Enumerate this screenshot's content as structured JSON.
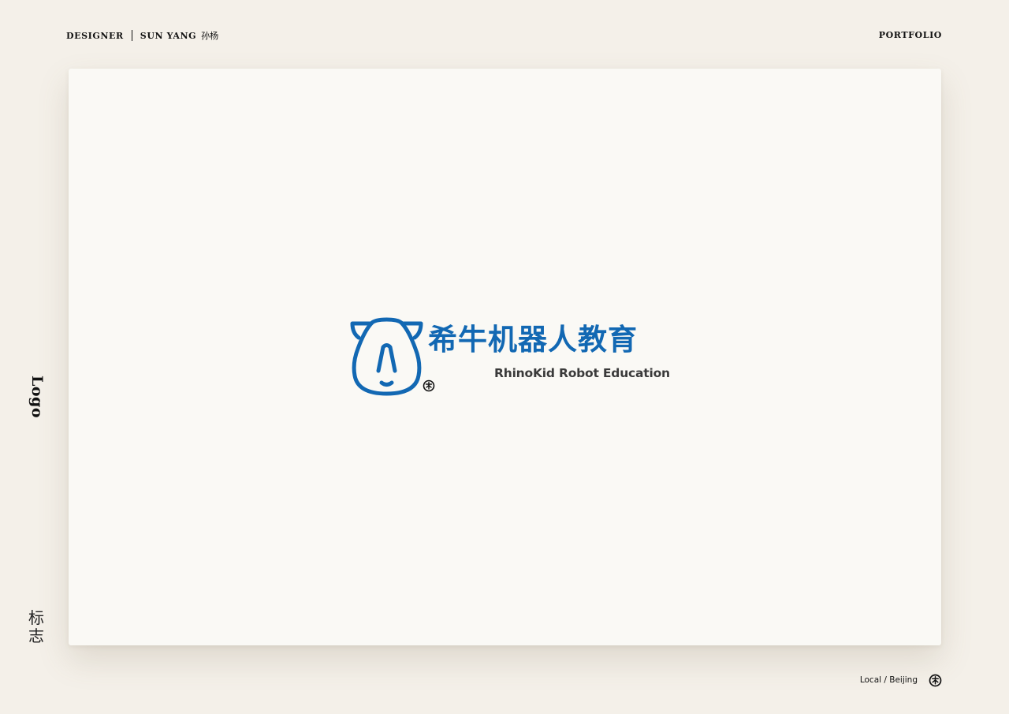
{
  "header": {
    "designer_label": "DESIGNER",
    "designer_name": "SUN YANG",
    "designer_name_cn": "孙杨",
    "portfolio_label": "PORTFOLIO"
  },
  "sidebar": {
    "title_en": "Logo",
    "title_cn": "标志"
  },
  "logo": {
    "name_cn": "希牛机器人教育",
    "name_en": "RhinoKid Robot Education",
    "icon": "rhino-head-icon",
    "brand_color": "#1268b3",
    "text_color": "#3a3a3a"
  },
  "footer": {
    "location": "Local / Beijing",
    "badge_icon": "seal-icon"
  }
}
